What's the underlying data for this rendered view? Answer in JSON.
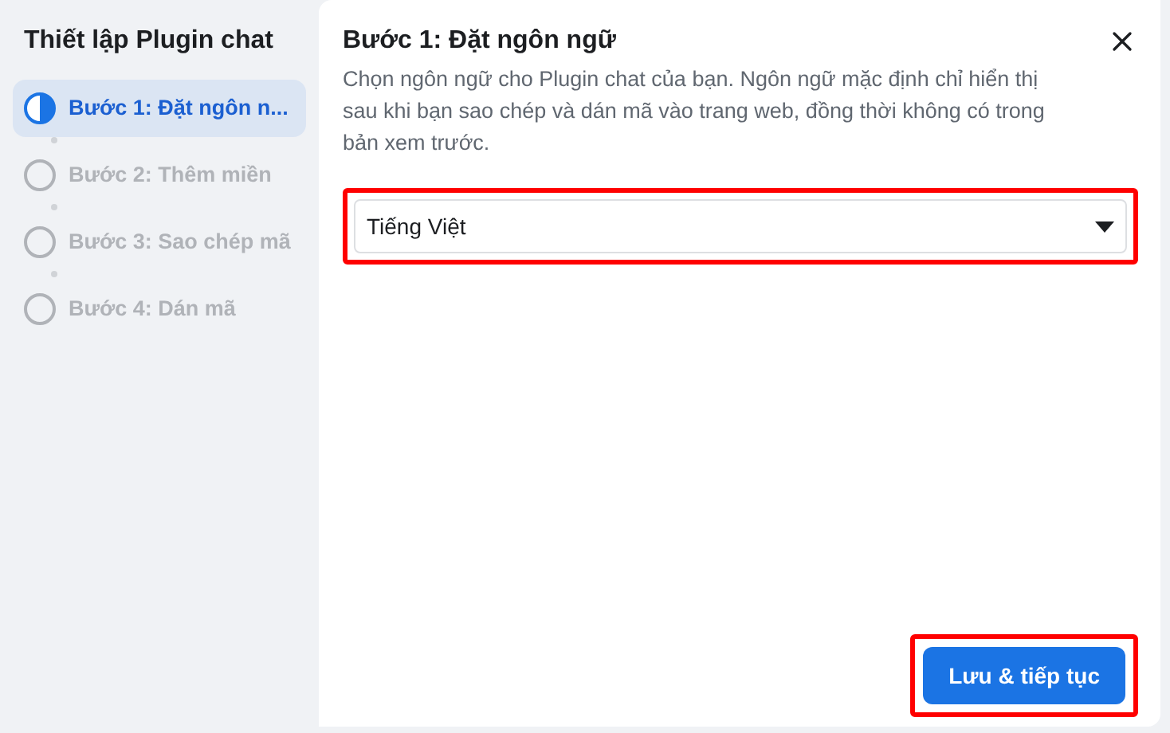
{
  "sidebar": {
    "title": "Thiết lập Plugin chat",
    "steps": [
      {
        "label": "Bước 1: Đặt ngôn n...",
        "selected": true
      },
      {
        "label": "Bước 2: Thêm miền",
        "selected": false
      },
      {
        "label": "Bước 3: Sao chép mã",
        "selected": false
      },
      {
        "label": "Bước 4: Dán mã",
        "selected": false
      }
    ]
  },
  "main": {
    "title": "Bước 1: Đặt ngôn ngữ",
    "description": "Chọn ngôn ngữ cho Plugin chat của bạn. Ngôn ngữ mặc định chỉ hiển thị sau khi bạn sao chép và dán mã vào trang web, đồng thời không có trong bản xem trước.",
    "language_select": {
      "value": "Tiếng Việt",
      "highlighted": true
    },
    "save_button": {
      "label": "Lưu & tiếp tục",
      "highlighted": true
    }
  }
}
